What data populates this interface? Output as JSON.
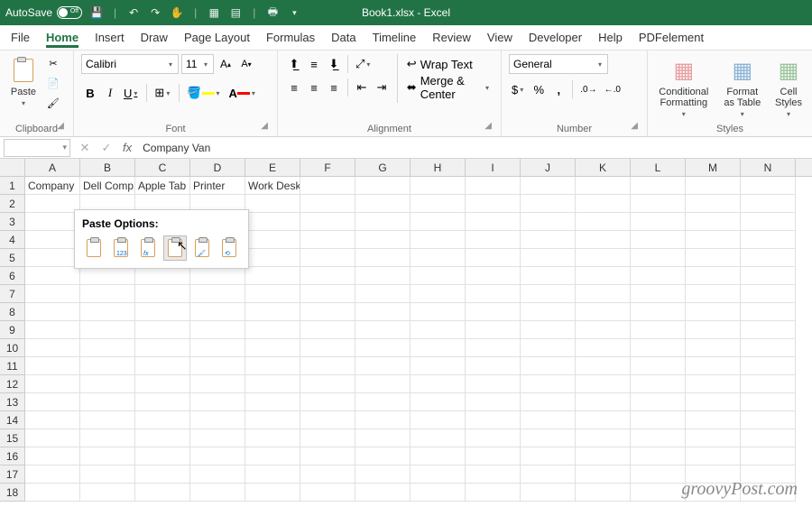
{
  "titlebar": {
    "autosave_label": "AutoSave",
    "autosave_state": "Off",
    "filename": "Book1.xlsx",
    "app_name": "Excel"
  },
  "tabs": [
    "File",
    "Home",
    "Insert",
    "Draw",
    "Page Layout",
    "Formulas",
    "Data",
    "Timeline",
    "Review",
    "View",
    "Developer",
    "Help",
    "PDFelement"
  ],
  "active_tab": "Home",
  "ribbon": {
    "clipboard": {
      "label": "Clipboard",
      "paste": "Paste"
    },
    "font": {
      "label": "Font",
      "name": "Calibri",
      "size": "11",
      "bold": "B",
      "italic": "I",
      "underline": "U"
    },
    "alignment": {
      "label": "Alignment",
      "wrap": "Wrap Text",
      "merge": "Merge & Center"
    },
    "number": {
      "label": "Number",
      "format": "General"
    },
    "styles": {
      "label": "Styles",
      "cond": "Conditional Formatting",
      "table": "Format as Table",
      "cell": "Cell Styles"
    }
  },
  "formula_bar": {
    "name_box": "",
    "value": "Company Van"
  },
  "columns": [
    "A",
    "B",
    "C",
    "D",
    "E",
    "F",
    "G",
    "H",
    "I",
    "J",
    "K",
    "L",
    "M",
    "N"
  ],
  "rows": [
    "1",
    "2",
    "3",
    "4",
    "5",
    "6",
    "7",
    "8",
    "9",
    "10",
    "11",
    "12",
    "13",
    "14",
    "15",
    "16",
    "17",
    "18"
  ],
  "cells": {
    "r0": [
      "Company",
      "Dell Comp",
      "Apple Tab",
      "Printer",
      "Work Desk",
      "",
      "",
      "",
      "",
      "",
      "",
      "",
      "",
      ""
    ]
  },
  "paste_popup": {
    "title": "Paste Options:",
    "options": [
      "paste",
      "values-123",
      "formulas-fx",
      "transpose",
      "formatting",
      "link"
    ]
  },
  "watermark": "groovyPost.com"
}
